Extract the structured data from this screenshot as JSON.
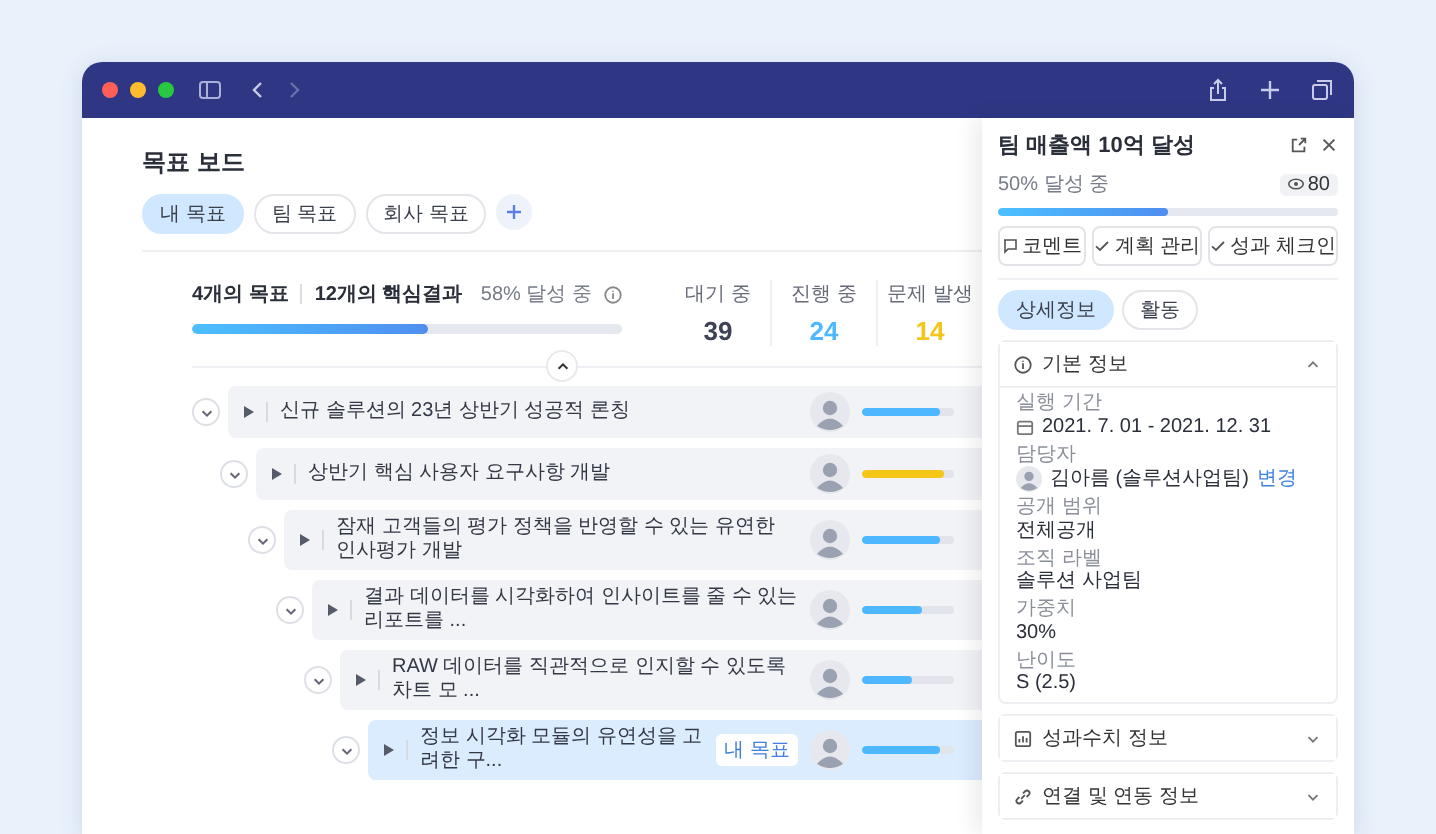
{
  "page_title": "목표 보드",
  "tabs": [
    {
      "label": "내 목표",
      "selected": true
    },
    {
      "label": "팀 목표",
      "selected": false
    },
    {
      "label": "회사 목표",
      "selected": false
    }
  ],
  "summary": {
    "objectives": "4개의 목표",
    "key_results": "12개의 핵심결과",
    "progress_label": "58% 달성 중",
    "level": 0.55
  },
  "stats": [
    {
      "label": "대기 중",
      "value": "39",
      "color": "#3d4257"
    },
    {
      "label": "진행 중",
      "value": "24",
      "color": "#4db8ff"
    },
    {
      "label": "문제 발생",
      "value": "14",
      "color": "#f5c518"
    }
  ],
  "goals": [
    {
      "title": "신규 솔루션의 23년 상반기 성공적 론칭",
      "expanded": true,
      "selected": false,
      "level": 0.85,
      "color": "#4db8ff",
      "children": [
        {
          "title": "상반기 핵심 사용자 요구사항 개발",
          "expanded": true,
          "selected": false,
          "level": 0.9,
          "color": "#f5c518",
          "children": [
            {
              "title": "잠재 고객들의 평가 정책을 반영할 수 있는 유연한 인사평가 개발",
              "expanded": true,
              "selected": false,
              "level": 0.85,
              "color": "#4db8ff",
              "children": [
                {
                  "title": "결과 데이터를 시각화하여 인사이트를 줄 수 있는 리포트를 ...",
                  "expanded": true,
                  "selected": false,
                  "level": 0.65,
                  "color": "#4db8ff",
                  "children": [
                    {
                      "title": "RAW 데이터를 직관적으로 인지할 수 있도록 차트 모 ...",
                      "expanded": true,
                      "selected": false,
                      "level": 0.55,
                      "color": "#4db8ff",
                      "children": [
                        {
                          "title": "정보 시각화 모듈의 유연성을 고려한 구...",
                          "badge": "내 목표",
                          "expanded": true,
                          "selected": true,
                          "level": 0.85,
                          "color": "#4db8ff"
                        }
                      ]
                    }
                  ]
                }
              ]
            }
          ]
        }
      ]
    }
  ],
  "panel": {
    "title": "팀 매출액 10억 달성",
    "progress_label": "50% 달성 중",
    "level": 0.5,
    "views": "80",
    "actions": [
      {
        "label": "코멘트",
        "kind": "comment"
      },
      {
        "label": "계획 관리",
        "kind": "check"
      },
      {
        "label": "성과 체크인",
        "kind": "check"
      }
    ],
    "tabs": [
      {
        "label": "상세정보",
        "selected": true
      },
      {
        "label": "활동",
        "selected": false
      }
    ],
    "sections": [
      {
        "title": "기본 정보",
        "kind": "info",
        "expanded": true,
        "fields": [
          {
            "label": "실행 기간",
            "value": "2021. 7. 01 - 2021. 12. 31",
            "kind": "date"
          },
          {
            "label": "담당자",
            "value": "김아름 (솔루션사업팀)",
            "link": "변경",
            "kind": "person"
          },
          {
            "label": "공개 범위",
            "value": "전체공개",
            "kind": "text"
          },
          {
            "label": "조직 라벨",
            "value": "솔루션 사업팀",
            "kind": "text"
          },
          {
            "label": "가중치",
            "value": "30%",
            "kind": "text"
          },
          {
            "label": "난이도",
            "value": "S (2.5)",
            "kind": "text"
          }
        ]
      },
      {
        "title": "성과수치 정보",
        "kind": "chart",
        "expanded": false
      },
      {
        "title": "연결 및 연동 정보",
        "kind": "link",
        "expanded": false
      }
    ]
  }
}
